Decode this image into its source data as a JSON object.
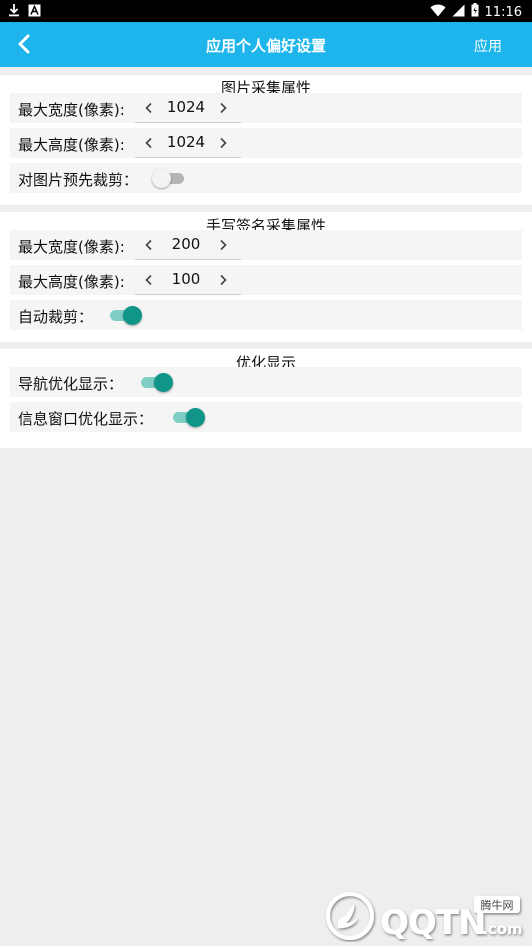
{
  "statusbar": {
    "time": "11:16",
    "left_icons": [
      "download-icon",
      "notification-app-icon"
    ],
    "right_icons": [
      "wifi-icon",
      "signal-icon",
      "battery-icon"
    ]
  },
  "appbar": {
    "title": "应用个人偏好设置",
    "apply": "应用",
    "color": "#1db5ec"
  },
  "image_section": {
    "title": "图片采集属性",
    "max_width_label": "最大宽度(像素):",
    "max_width_value": "1024",
    "max_height_label": "最大高度(像素):",
    "max_height_value": "1024",
    "precrop_label": "对图片预先裁剪：",
    "precrop_on": false
  },
  "signature_section": {
    "title": "手写签名采集属性",
    "max_width_label": "最大宽度(像素):",
    "max_width_value": "200",
    "max_height_label": "最大高度(像素):",
    "max_height_value": "100",
    "autocrop_label": "自动裁剪：",
    "autocrop_on": true
  },
  "display_section": {
    "title": "优化显示",
    "nav_label": "导航优化显示：",
    "nav_on": true,
    "info_label": "信息窗口优化显示：",
    "info_on": true
  },
  "watermark": {
    "brand_cn": "腾牛网",
    "brand": "QQTN",
    "suffix": ".com"
  },
  "colors": {
    "toggle_on_knob": "#0f9688",
    "toggle_on_track": "#7fcfc7",
    "toggle_off_track": "#b5b5b5"
  }
}
